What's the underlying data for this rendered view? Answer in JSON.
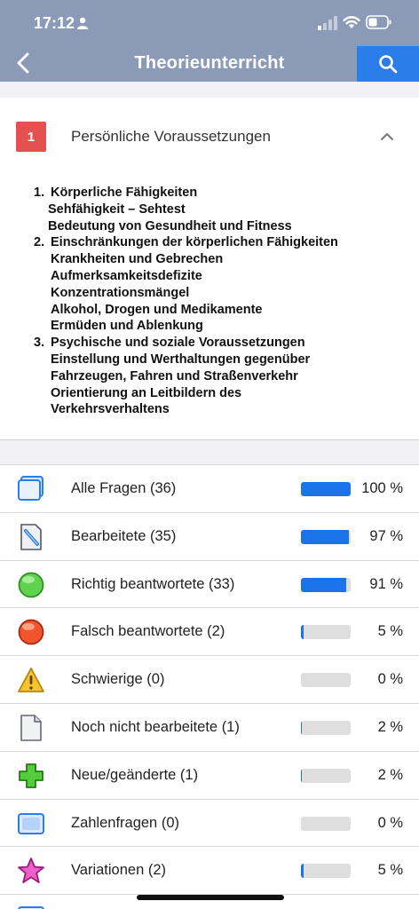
{
  "status": {
    "time": "17:12"
  },
  "nav": {
    "title": "Theorieunterricht"
  },
  "section": {
    "number": "1",
    "title": "Persönliche Voraussetzungen",
    "outline": [
      {
        "num": "1.",
        "title": "Körperliche Fähigkeiten",
        "subs": [
          "Sehfähigkeit – Sehtest",
          "Bedeutung von Gesundheit und Fitness"
        ]
      },
      {
        "num": "2.",
        "title": "Einschränkungen der körperlichen Fähigkeiten",
        "subs": [
          "Krankheiten und Gebrechen",
          "Aufmerksamkeitsdefizite",
          "Konzentrationsmängel",
          "Alkohol, Drogen und Medikamente",
          "Ermüden und Ablenkung"
        ]
      },
      {
        "num": "3.",
        "title": "Psychische und soziale Voraussetzungen",
        "subs": [
          "Einstellung und Werthaltungen gegenüber",
          "Fahrzeugen, Fahren und Straßenverkehr",
          "Orientierung an Leitbildern des",
          "Verkehrsverhaltens"
        ]
      }
    ]
  },
  "categories": [
    {
      "icon": "all-questions-icon",
      "label": "Alle Fragen (36)",
      "progress": 1.0,
      "percent": "100 %"
    },
    {
      "icon": "edited-icon",
      "label": "Bearbeitete (35)",
      "progress": 0.97,
      "percent": "97 %"
    },
    {
      "icon": "correct-icon",
      "label": "Richtig beantwortete (33)",
      "progress": 0.91,
      "percent": "91 %"
    },
    {
      "icon": "wrong-icon",
      "label": "Falsch beantwortete (2)",
      "progress": 0.05,
      "percent": "5 %"
    },
    {
      "icon": "warning-icon",
      "label": "Schwierige (0)",
      "progress": 0.0,
      "percent": "0 %"
    },
    {
      "icon": "document-icon",
      "label": "Noch nicht bearbeitete (1)",
      "progress": 0.02,
      "percent": "2 %"
    },
    {
      "icon": "plus-icon",
      "label": "Neue/geänderte (1)",
      "progress": 0.02,
      "percent": "2 %"
    },
    {
      "icon": "number-icon",
      "label": "Zahlenfragen (0)",
      "progress": 0.0,
      "percent": "0 %"
    },
    {
      "icon": "star-icon",
      "label": "Variationen (2)",
      "progress": 0.05,
      "percent": "5 %"
    }
  ],
  "colors": {
    "header": "#8b9bb7",
    "accent": "#2b7de9",
    "badge": "#e55050",
    "progress": "#1a73e8"
  }
}
